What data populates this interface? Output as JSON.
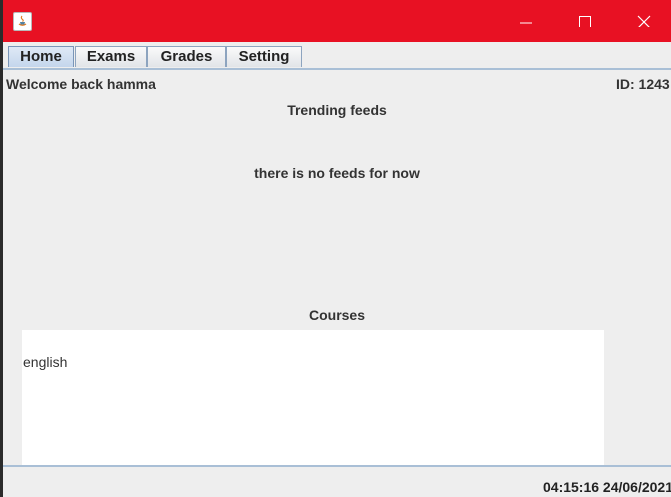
{
  "window": {
    "title": "",
    "titlebar_color": "#e81123",
    "controls": [
      "minimize-icon",
      "maximize-icon",
      "close-icon"
    ]
  },
  "tabs": [
    {
      "label": "Home",
      "selected": true
    },
    {
      "label": "Exams",
      "selected": false
    },
    {
      "label": "Grades",
      "selected": false
    },
    {
      "label": "Setting",
      "selected": false
    }
  ],
  "home": {
    "welcome": "Welcome back hamma",
    "id_text": "ID: 1243",
    "feeds_title": "Trending feeds",
    "feeds_empty": "there is no feeds for now",
    "courses_title": "Courses",
    "courses": [
      "english"
    ]
  },
  "status": {
    "clock": "04:15:16 24/06/2021"
  }
}
